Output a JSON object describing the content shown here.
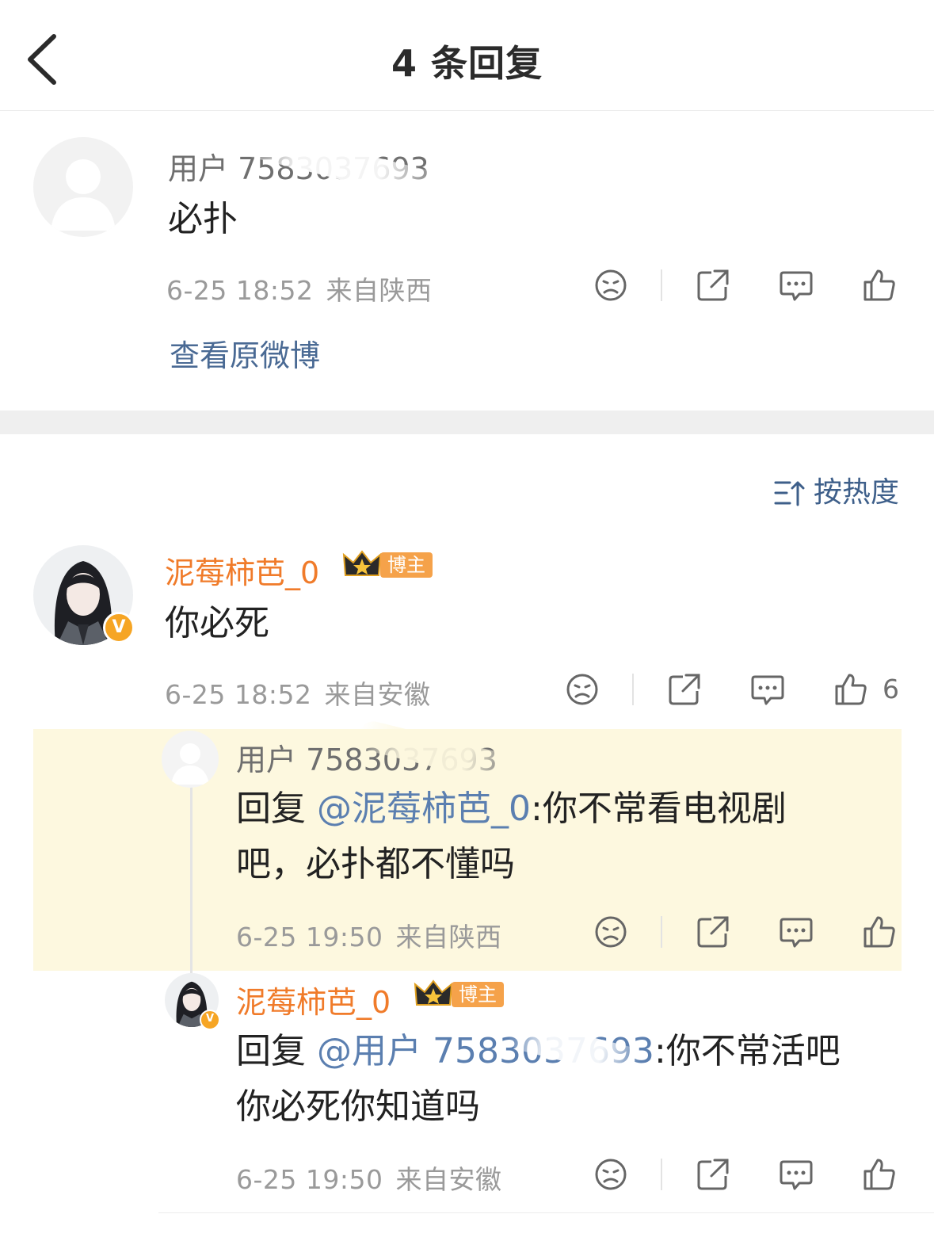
{
  "header": {
    "title": "4 条回复",
    "back_icon": "chevron-left-icon"
  },
  "original": {
    "username": "用户 7583037693",
    "text": "必扑",
    "date": "6-25 18:52",
    "location": "来自陕西",
    "view_original": "查看原微博"
  },
  "sort": {
    "label": "按热度",
    "icon": "sort-icon"
  },
  "comment": {
    "username": "泥莓柿芭_0",
    "badge": "博主",
    "text": "你必死",
    "date": "6-25 18:52",
    "location": "来自安徽",
    "likes": "6"
  },
  "reply1": {
    "username": "用户 7583037693",
    "reply_prefix": "回复 ",
    "mention": "@泥莓柿芭_0",
    "text_line1": ":你不常看电视剧",
    "text_line2": "吧，必扑都不懂吗",
    "date": "6-25 19:50",
    "location": "来自陕西"
  },
  "reply2": {
    "username": "泥莓柿芭_0",
    "badge": "博主",
    "reply_prefix": "回复 ",
    "mention": "@用户 7583037693",
    "text_line1": ":你不常活吧",
    "text_line2": "你必死你知道吗",
    "date": "6-25 19:50",
    "location": "来自安徽"
  },
  "colors": {
    "accent_orange": "#f07b2a",
    "link_blue": "#4a6a94",
    "highlight_bg": "#fdf8df"
  }
}
